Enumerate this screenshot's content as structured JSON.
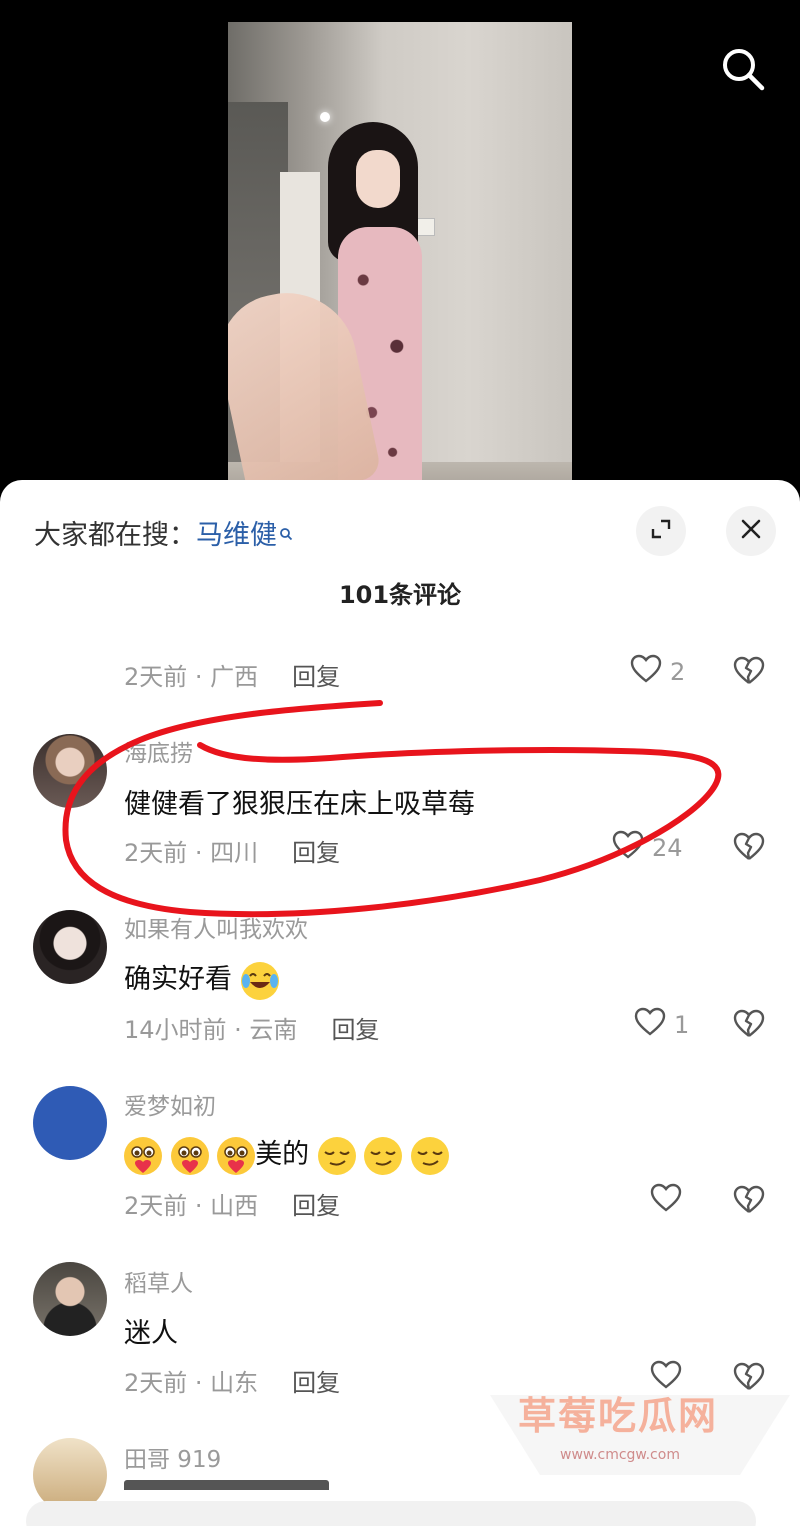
{
  "top_bar": {
    "search_icon": "search-icon"
  },
  "sheet": {
    "trending_prefix": "大家都在搜：",
    "trending_keyword": "马维健",
    "comment_count": "101条评论",
    "expand_icon": "expand-icon",
    "close_icon": "close-icon"
  },
  "comments": [
    {
      "time_location": "2天前 · 广西",
      "reply": "回复",
      "likes": "2"
    },
    {
      "username": "海底捞",
      "text": "健健看了狠狠压在床上吸草莓",
      "time_location": "2天前 · 四川",
      "reply": "回复",
      "likes": "24"
    },
    {
      "username": "如果有人叫我欢欢",
      "text": "确实好看",
      "time_location": "14小时前 · 云南",
      "reply": "回复",
      "likes": "1"
    },
    {
      "username": "爱梦如初",
      "text_middle": "美的",
      "time_location": "2天前 · 山西",
      "reply": "回复"
    },
    {
      "username": "稻草人",
      "text": "迷人",
      "time_location": "2天前 · 山东",
      "reply": "回复"
    },
    {
      "username": "田哥 919"
    }
  ],
  "watermark": {
    "title": "草莓吃瓜网",
    "url": "www.cmcgw.com"
  },
  "colors": {
    "accent_link": "#2b5fa8",
    "annotation_red": "#e8141c",
    "avatar_blue": "#2f5bb5"
  }
}
